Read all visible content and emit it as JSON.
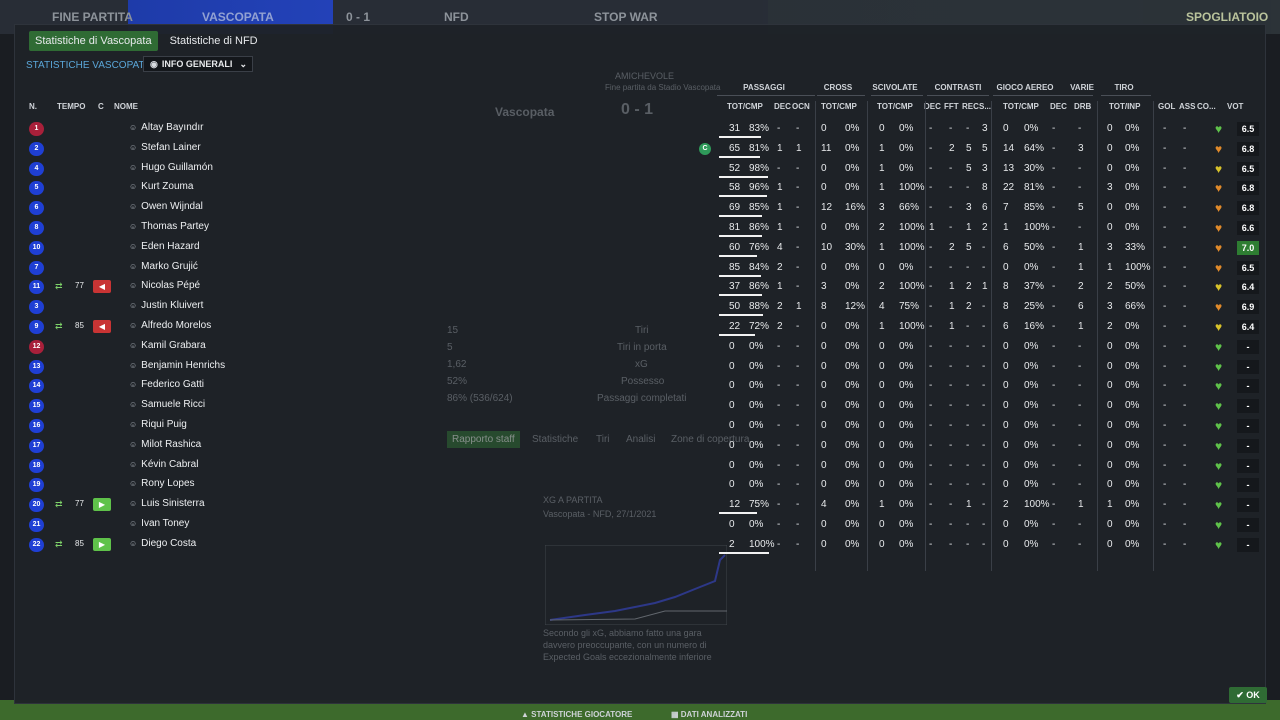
{
  "topbar": {
    "item1": "FINE PARTITA",
    "home_team": "VASCOPATA",
    "score": "0 - 1",
    "away_team": "NFD",
    "stop": "STOP WAR",
    "tempo": "Tempo",
    "right_label": "SPOGLIATOIO"
  },
  "tabs": [
    {
      "label": "Statistiche di Vascopata",
      "active": true
    },
    {
      "label": "Statistiche di NFD",
      "active": false
    }
  ],
  "team_stats_title": "STATISTICHE VASCOPATA",
  "view_select": "INFO GENERALI",
  "columns": {
    "n": "N.",
    "tempo": "TEMPO",
    "c": "C",
    "nome": "NOME",
    "passaggi": "PASSAGGI",
    "cross": "CROSS",
    "scivolate": "SCIVOLATE",
    "contrasti": "CONTRASTI",
    "gioco_aereo": "GIOCO AEREO",
    "varie": "VARIE",
    "tiro": "TIRO",
    "tot_cmp": "TOT/CMP",
    "dec": "DEC",
    "ocn": "OCN",
    "fft": "FFT",
    "rec": "REC",
    "s": "S...",
    "drb": "DRB",
    "tot_inp": "TOT/INP",
    "gol": "GOL",
    "ass": "ASS",
    "co": "CO...",
    "vot": "VOT"
  },
  "players": [
    {
      "num": "1",
      "gk": true,
      "name": "Altay Bayındır",
      "pas": "31",
      "pas_pct": "83%",
      "pas_dec": "-",
      "pas_ocn": "-",
      "cr": "0",
      "cr_pct": "0%",
      "sc": "0",
      "sc_pct": "0%",
      "c1": "-",
      "c2": "-",
      "c3": "-",
      "c4": "3",
      "ga": "0",
      "ga_pct": "0%",
      "ga_dec": "-",
      "drb": "-",
      "ti": "0",
      "ti_pct": "0%",
      "gol": "-",
      "ass": "-",
      "vot": "6.5",
      "heart": "green",
      "pas_bar": 0.83
    },
    {
      "num": "2",
      "name": "Stefan Lainer",
      "pas": "65",
      "pas_pct": "81%",
      "pas_dec": "1",
      "pas_ocn": "1",
      "cr": "11",
      "cr_pct": "0%",
      "sc": "1",
      "sc_pct": "0%",
      "c1": "-",
      "c2": "2",
      "c3": "5",
      "c4": "5",
      "ga": "14",
      "ga_pct": "64%",
      "ga_dec": "-",
      "drb": "3",
      "ti": "0",
      "ti_pct": "0%",
      "gol": "-",
      "ass": "-",
      "vot": "6.8",
      "heart": "orange",
      "pas_bar": 0.81,
      "captain": true
    },
    {
      "num": "4",
      "name": "Hugo Guillamón",
      "pas": "52",
      "pas_pct": "98%",
      "pas_dec": "-",
      "pas_ocn": "-",
      "cr": "0",
      "cr_pct": "0%",
      "sc": "1",
      "sc_pct": "0%",
      "c1": "-",
      "c2": "-",
      "c3": "5",
      "c4": "3",
      "ga": "13",
      "ga_pct": "30%",
      "ga_dec": "-",
      "drb": "-",
      "ti": "0",
      "ti_pct": "0%",
      "gol": "-",
      "ass": "-",
      "vot": "6.5",
      "heart": "yellow",
      "pas_bar": 0.98
    },
    {
      "num": "5",
      "name": "Kurt Zouma",
      "pas": "58",
      "pas_pct": "96%",
      "pas_dec": "1",
      "pas_ocn": "-",
      "cr": "0",
      "cr_pct": "0%",
      "sc": "1",
      "sc_pct": "100%",
      "c1": "-",
      "c2": "-",
      "c3": "-",
      "c4": "8",
      "ga": "22",
      "ga_pct": "81%",
      "ga_dec": "-",
      "drb": "-",
      "ti": "3",
      "ti_pct": "0%",
      "gol": "-",
      "ass": "-",
      "vot": "6.8",
      "heart": "orange",
      "pas_bar": 0.96
    },
    {
      "num": "6",
      "name": "Owen Wijndal",
      "pas": "69",
      "pas_pct": "85%",
      "pas_dec": "1",
      "pas_ocn": "-",
      "cr": "12",
      "cr_pct": "16%",
      "sc": "3",
      "sc_pct": "66%",
      "c1": "-",
      "c2": "-",
      "c3": "3",
      "c4": "6",
      "ga": "7",
      "ga_pct": "85%",
      "ga_dec": "-",
      "drb": "5",
      "ti": "0",
      "ti_pct": "0%",
      "gol": "-",
      "ass": "-",
      "vot": "6.8",
      "heart": "orange",
      "pas_bar": 0.85
    },
    {
      "num": "8",
      "name": "Thomas Partey",
      "pas": "81",
      "pas_pct": "86%",
      "pas_dec": "1",
      "pas_ocn": "-",
      "cr": "0",
      "cr_pct": "0%",
      "sc": "2",
      "sc_pct": "100%",
      "c1": "1",
      "c2": "-",
      "c3": "1",
      "c4": "2",
      "ga": "1",
      "ga_pct": "100%",
      "ga_dec": "-",
      "drb": "-",
      "ti": "0",
      "ti_pct": "0%",
      "gol": "-",
      "ass": "-",
      "vot": "6.6",
      "heart": "orange",
      "pas_bar": 0.86
    },
    {
      "num": "10",
      "name": "Eden Hazard",
      "pas": "60",
      "pas_pct": "76%",
      "pas_dec": "4",
      "pas_ocn": "-",
      "cr": "10",
      "cr_pct": "30%",
      "sc": "1",
      "sc_pct": "100%",
      "c1": "-",
      "c2": "2",
      "c3": "5",
      "c4": "-",
      "ga": "6",
      "ga_pct": "50%",
      "ga_dec": "-",
      "drb": "1",
      "ti": "3",
      "ti_pct": "33%",
      "gol": "-",
      "ass": "-",
      "vot": "7.0",
      "heart": "orange",
      "pas_bar": 0.76,
      "best": true
    },
    {
      "num": "7",
      "name": "Marko Grujić",
      "pas": "85",
      "pas_pct": "84%",
      "pas_dec": "2",
      "pas_ocn": "-",
      "cr": "0",
      "cr_pct": "0%",
      "sc": "0",
      "sc_pct": "0%",
      "c1": "-",
      "c2": "-",
      "c3": "-",
      "c4": "-",
      "ga": "0",
      "ga_pct": "0%",
      "ga_dec": "-",
      "drb": "1",
      "ti": "1",
      "ti_pct": "100%",
      "gol": "-",
      "ass": "-",
      "vot": "6.5",
      "heart": "orange",
      "pas_bar": 0.84
    },
    {
      "num": "11",
      "name": "Nicolas Pépé",
      "pas": "37",
      "pas_pct": "86%",
      "pas_dec": "1",
      "pas_ocn": "-",
      "cr": "3",
      "cr_pct": "0%",
      "sc": "2",
      "sc_pct": "100%",
      "c1": "-",
      "c2": "1",
      "c3": "2",
      "c4": "1",
      "ga": "8",
      "ga_pct": "37%",
      "ga_dec": "-",
      "drb": "2",
      "ti": "2",
      "ti_pct": "50%",
      "gol": "-",
      "ass": "-",
      "vot": "6.4",
      "heart": "yellow",
      "pas_bar": 0.86,
      "sub": "out",
      "sub_min": "77"
    },
    {
      "num": "3",
      "name": "Justin Kluivert",
      "pas": "50",
      "pas_pct": "88%",
      "pas_dec": "2",
      "pas_ocn": "1",
      "cr": "8",
      "cr_pct": "12%",
      "sc": "4",
      "sc_pct": "75%",
      "c1": "-",
      "c2": "1",
      "c3": "2",
      "c4": "-",
      "ga": "8",
      "ga_pct": "25%",
      "ga_dec": "-",
      "drb": "6",
      "ti": "3",
      "ti_pct": "66%",
      "gol": "-",
      "ass": "-",
      "vot": "6.9",
      "heart": "orange",
      "pas_bar": 0.88
    },
    {
      "num": "9",
      "name": "Alfredo Morelos",
      "pas": "22",
      "pas_pct": "72%",
      "pas_dec": "2",
      "pas_ocn": "-",
      "cr": "0",
      "cr_pct": "0%",
      "sc": "1",
      "sc_pct": "100%",
      "c1": "-",
      "c2": "1",
      "c3": "-",
      "c4": "-",
      "ga": "6",
      "ga_pct": "16%",
      "ga_dec": "-",
      "drb": "1",
      "ti": "2",
      "ti_pct": "0%",
      "gol": "-",
      "ass": "-",
      "vot": "6.4",
      "heart": "yellow",
      "pas_bar": 0.72,
      "sub": "out",
      "sub_min": "85"
    },
    {
      "num": "12",
      "gk": true,
      "name": "Kamil Grabara",
      "pas": "0",
      "pas_pct": "0%",
      "pas_dec": "-",
      "pas_ocn": "-",
      "cr": "0",
      "cr_pct": "0%",
      "sc": "0",
      "sc_pct": "0%",
      "c1": "-",
      "c2": "-",
      "c3": "-",
      "c4": "-",
      "ga": "0",
      "ga_pct": "0%",
      "ga_dec": "-",
      "drb": "-",
      "ti": "0",
      "ti_pct": "0%",
      "gol": "-",
      "ass": "-",
      "vot": "-",
      "heart": "green",
      "pas_bar": 0
    },
    {
      "num": "13",
      "name": "Benjamin Henrichs",
      "pas": "0",
      "pas_pct": "0%",
      "pas_dec": "-",
      "pas_ocn": "-",
      "cr": "0",
      "cr_pct": "0%",
      "sc": "0",
      "sc_pct": "0%",
      "c1": "-",
      "c2": "-",
      "c3": "-",
      "c4": "-",
      "ga": "0",
      "ga_pct": "0%",
      "ga_dec": "-",
      "drb": "-",
      "ti": "0",
      "ti_pct": "0%",
      "gol": "-",
      "ass": "-",
      "vot": "-",
      "heart": "green",
      "pas_bar": 0
    },
    {
      "num": "14",
      "name": "Federico Gatti",
      "pas": "0",
      "pas_pct": "0%",
      "pas_dec": "-",
      "pas_ocn": "-",
      "cr": "0",
      "cr_pct": "0%",
      "sc": "0",
      "sc_pct": "0%",
      "c1": "-",
      "c2": "-",
      "c3": "-",
      "c4": "-",
      "ga": "0",
      "ga_pct": "0%",
      "ga_dec": "-",
      "drb": "-",
      "ti": "0",
      "ti_pct": "0%",
      "gol": "-",
      "ass": "-",
      "vot": "-",
      "heart": "green",
      "pas_bar": 0
    },
    {
      "num": "15",
      "name": "Samuele Ricci",
      "pas": "0",
      "pas_pct": "0%",
      "pas_dec": "-",
      "pas_ocn": "-",
      "cr": "0",
      "cr_pct": "0%",
      "sc": "0",
      "sc_pct": "0%",
      "c1": "-",
      "c2": "-",
      "c3": "-",
      "c4": "-",
      "ga": "0",
      "ga_pct": "0%",
      "ga_dec": "-",
      "drb": "-",
      "ti": "0",
      "ti_pct": "0%",
      "gol": "-",
      "ass": "-",
      "vot": "-",
      "heart": "green",
      "pas_bar": 0
    },
    {
      "num": "16",
      "name": "Riqui Puig",
      "pas": "0",
      "pas_pct": "0%",
      "pas_dec": "-",
      "pas_ocn": "-",
      "cr": "0",
      "cr_pct": "0%",
      "sc": "0",
      "sc_pct": "0%",
      "c1": "-",
      "c2": "-",
      "c3": "-",
      "c4": "-",
      "ga": "0",
      "ga_pct": "0%",
      "ga_dec": "-",
      "drb": "-",
      "ti": "0",
      "ti_pct": "0%",
      "gol": "-",
      "ass": "-",
      "vot": "-",
      "heart": "green",
      "pas_bar": 0
    },
    {
      "num": "17",
      "name": "Milot Rashica",
      "pas": "0",
      "pas_pct": "0%",
      "pas_dec": "-",
      "pas_ocn": "-",
      "cr": "0",
      "cr_pct": "0%",
      "sc": "0",
      "sc_pct": "0%",
      "c1": "-",
      "c2": "-",
      "c3": "-",
      "c4": "-",
      "ga": "0",
      "ga_pct": "0%",
      "ga_dec": "-",
      "drb": "-",
      "ti": "0",
      "ti_pct": "0%",
      "gol": "-",
      "ass": "-",
      "vot": "-",
      "heart": "green",
      "pas_bar": 0
    },
    {
      "num": "18",
      "name": "Kévin Cabral",
      "pas": "0",
      "pas_pct": "0%",
      "pas_dec": "-",
      "pas_ocn": "-",
      "cr": "0",
      "cr_pct": "0%",
      "sc": "0",
      "sc_pct": "0%",
      "c1": "-",
      "c2": "-",
      "c3": "-",
      "c4": "-",
      "ga": "0",
      "ga_pct": "0%",
      "ga_dec": "-",
      "drb": "-",
      "ti": "0",
      "ti_pct": "0%",
      "gol": "-",
      "ass": "-",
      "vot": "-",
      "heart": "green",
      "pas_bar": 0
    },
    {
      "num": "19",
      "name": "Rony Lopes",
      "pas": "0",
      "pas_pct": "0%",
      "pas_dec": "-",
      "pas_ocn": "-",
      "cr": "0",
      "cr_pct": "0%",
      "sc": "0",
      "sc_pct": "0%",
      "c1": "-",
      "c2": "-",
      "c3": "-",
      "c4": "-",
      "ga": "0",
      "ga_pct": "0%",
      "ga_dec": "-",
      "drb": "-",
      "ti": "0",
      "ti_pct": "0%",
      "gol": "-",
      "ass": "-",
      "vot": "-",
      "heart": "green",
      "pas_bar": 0
    },
    {
      "num": "20",
      "name": "Luis Sinisterra",
      "pas": "12",
      "pas_pct": "75%",
      "pas_dec": "-",
      "pas_ocn": "-",
      "cr": "4",
      "cr_pct": "0%",
      "sc": "1",
      "sc_pct": "0%",
      "c1": "-",
      "c2": "-",
      "c3": "1",
      "c4": "-",
      "ga": "2",
      "ga_pct": "100%",
      "ga_dec": "-",
      "drb": "1",
      "ti": "1",
      "ti_pct": "0%",
      "gol": "-",
      "ass": "-",
      "vot": "-",
      "heart": "green",
      "pas_bar": 0.75,
      "sub": "in",
      "sub_min": "77"
    },
    {
      "num": "21",
      "name": "Ivan Toney",
      "pas": "0",
      "pas_pct": "0%",
      "pas_dec": "-",
      "pas_ocn": "-",
      "cr": "0",
      "cr_pct": "0%",
      "sc": "0",
      "sc_pct": "0%",
      "c1": "-",
      "c2": "-",
      "c3": "-",
      "c4": "-",
      "ga": "0",
      "ga_pct": "0%",
      "ga_dec": "-",
      "drb": "-",
      "ti": "0",
      "ti_pct": "0%",
      "gol": "-",
      "ass": "-",
      "vot": "-",
      "heart": "green",
      "pas_bar": 0
    },
    {
      "num": "22",
      "name": "Diego Costa",
      "pas": "2",
      "pas_pct": "100%",
      "pas_dec": "-",
      "pas_ocn": "-",
      "cr": "0",
      "cr_pct": "0%",
      "sc": "0",
      "sc_pct": "0%",
      "c1": "-",
      "c2": "-",
      "c3": "-",
      "c4": "-",
      "ga": "0",
      "ga_pct": "0%",
      "ga_dec": "-",
      "drb": "-",
      "ti": "0",
      "ti_pct": "0%",
      "gol": "-",
      "ass": "-",
      "vot": "-",
      "heart": "green",
      "pas_bar": 1.0,
      "sub": "in",
      "sub_min": "85"
    }
  ],
  "background": {
    "match_type": "AMICHEVOLE",
    "match_sub": "Fine partita da Stadio Vascopata",
    "home": "Vascopata",
    "score": "0 - 1",
    "stats": [
      {
        "v": "15",
        "l": "Tiri"
      },
      {
        "v": "5",
        "l": "Tiri in porta"
      },
      {
        "v": "1,62",
        "l": "xG"
      },
      {
        "v": "52%",
        "l": "Possesso"
      },
      {
        "v": "86% (536/624)",
        "l": "Passaggi completati"
      }
    ],
    "sub_tabs": [
      "Rapporto staff",
      "Statistiche",
      "Tiri",
      "Analisi",
      "Zone di copertura"
    ],
    "xg_title": "XG A PARTITA",
    "xg_sub": "Vascopata - NFD, 27/1/2021",
    "xg_text": "Secondo gli xG, abbiamo fatto una gara davvero preoccupante, con un numero di Expected Goals eccezionalmente inferiore",
    "bottom_link1": "STATISTICHE GIOCATORE",
    "bottom_link2": "DATI ANALIZZATI"
  },
  "ok_label": "OK",
  "colors": {
    "accent_green": "#2f6b34",
    "blue_badge": "#1f3fd4",
    "gk_badge": "#a8203a"
  }
}
